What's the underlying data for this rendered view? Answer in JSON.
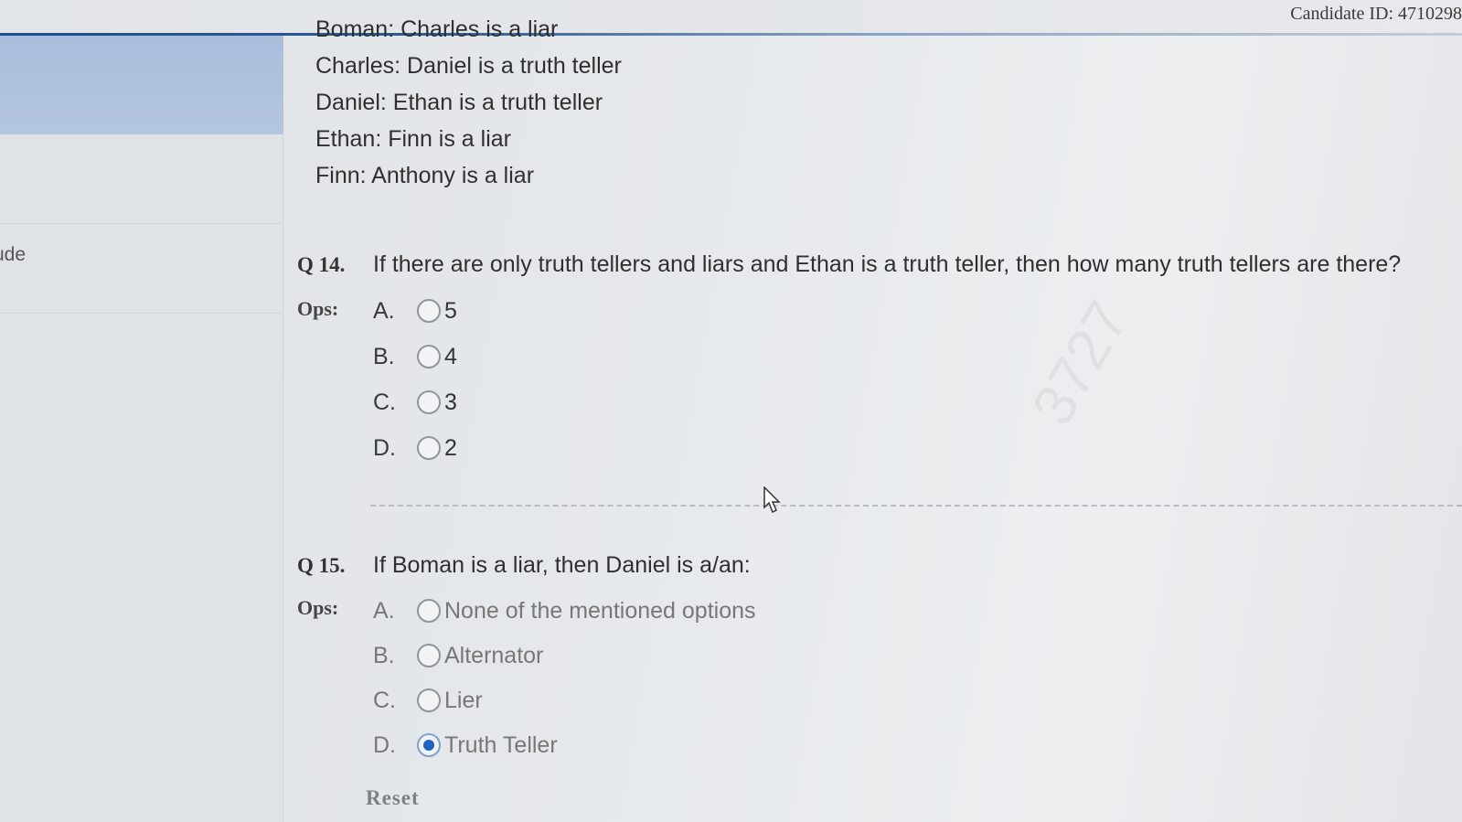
{
  "header": {
    "candidate_id": "Candidate ID: 4710298"
  },
  "sidebar": {
    "partial_item": "ude"
  },
  "statements": [
    "Boman: Charles is a liar",
    "Charles: Daniel is a truth teller",
    "Daniel: Ethan is a truth teller",
    "Ethan: Finn is a liar",
    "Finn: Anthony is a liar"
  ],
  "q14": {
    "number": "Q 14.",
    "text": "If there are only truth tellers and liars and Ethan is a truth teller, then how many truth tellers are there?",
    "ops_label": "Ops:",
    "options": [
      {
        "letter": "A.",
        "text": "5",
        "selected": false
      },
      {
        "letter": "B.",
        "text": "4",
        "selected": false
      },
      {
        "letter": "C.",
        "text": "3",
        "selected": false
      },
      {
        "letter": "D.",
        "text": "2",
        "selected": false
      }
    ]
  },
  "q15": {
    "number": "Q 15.",
    "text": "If Boman is a liar, then Daniel is a/an:",
    "ops_label": "Ops:",
    "options": [
      {
        "letter": "A.",
        "text": "None of the mentioned options",
        "selected": false
      },
      {
        "letter": "B.",
        "text": "Alternator",
        "selected": false
      },
      {
        "letter": "C.",
        "text": "Lier",
        "selected": false
      },
      {
        "letter": "D.",
        "text": "Truth Teller",
        "selected": true
      }
    ],
    "reset_label": "Reset"
  },
  "colors": {
    "accent": "#1d4f8c",
    "sidebar_active": "#a9bedb",
    "radio_selected": "#1f62c2"
  }
}
